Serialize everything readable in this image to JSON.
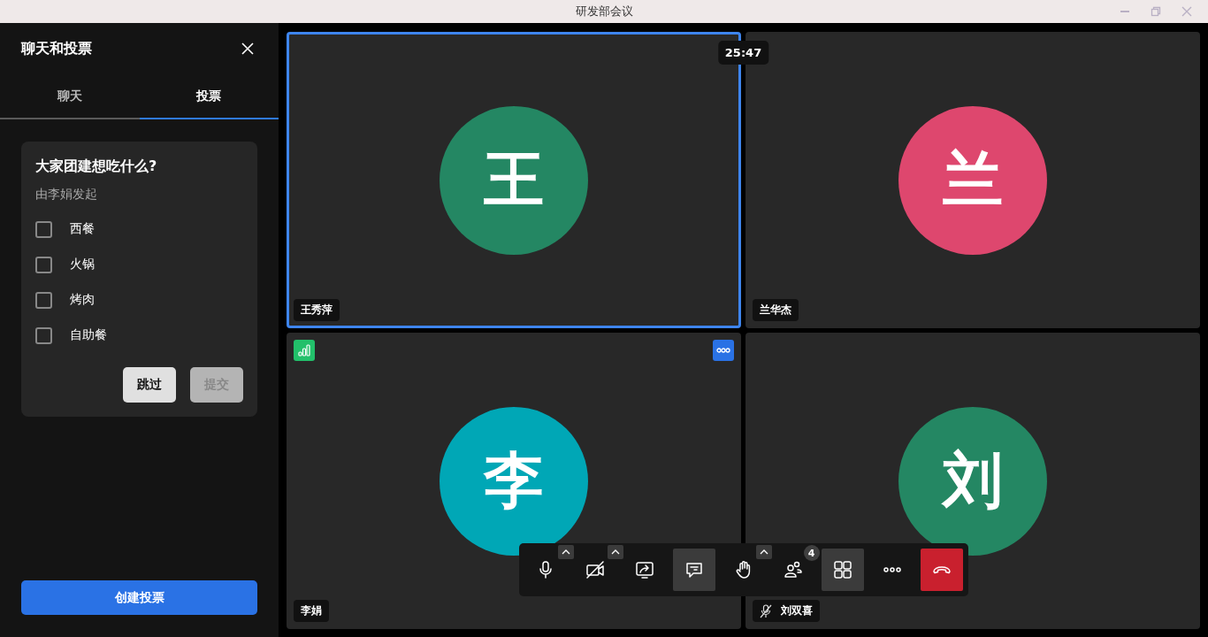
{
  "window": {
    "title": "研发部会议"
  },
  "sidebar": {
    "title": "聊天和投票",
    "tabs": [
      {
        "label": "聊天",
        "selected": false
      },
      {
        "label": "投票",
        "selected": true
      }
    ],
    "poll": {
      "question": "大家团建想吃什么?",
      "initiator": "由李娟发起",
      "options": [
        {
          "label": "西餐",
          "checked": false
        },
        {
          "label": "火锅",
          "checked": false
        },
        {
          "label": "烤肉",
          "checked": false
        },
        {
          "label": "自助餐",
          "checked": false
        }
      ],
      "buttons": [
        {
          "label": "跳过",
          "disabled": false
        },
        {
          "label": "提交",
          "disabled": true
        }
      ]
    },
    "create_button": "创建投票"
  },
  "timer": "25:47",
  "participants": [
    {
      "name": "王秀萍",
      "initial": "王",
      "color": "#248763",
      "selected": true,
      "muted": false,
      "signal": false,
      "menu": false
    },
    {
      "name": "兰华杰",
      "initial": "兰",
      "color": "#de476e",
      "selected": false,
      "muted": false,
      "signal": false,
      "menu": false
    },
    {
      "name": "李娟",
      "initial": "李",
      "color": "#00a7b6",
      "selected": false,
      "muted": false,
      "signal": true,
      "menu": true
    },
    {
      "name": "刘双喜",
      "initial": "刘",
      "color": "#248763",
      "selected": false,
      "muted": true,
      "signal": false,
      "menu": false
    }
  ],
  "toolbar": [
    {
      "kind": "mic",
      "selected": false,
      "menu": true
    },
    {
      "kind": "camera-off",
      "selected": false,
      "menu": true
    },
    {
      "kind": "share",
      "selected": false,
      "menu": false
    },
    {
      "kind": "chat",
      "selected": true,
      "menu": false
    },
    {
      "kind": "hand",
      "selected": false,
      "menu": true
    },
    {
      "kind": "participants",
      "selected": false,
      "menu": false,
      "badge": "4"
    },
    {
      "kind": "layout",
      "selected": true,
      "menu": false
    },
    {
      "kind": "more",
      "selected": false,
      "menu": false
    },
    {
      "kind": "end",
      "selected": false,
      "menu": false
    }
  ]
}
